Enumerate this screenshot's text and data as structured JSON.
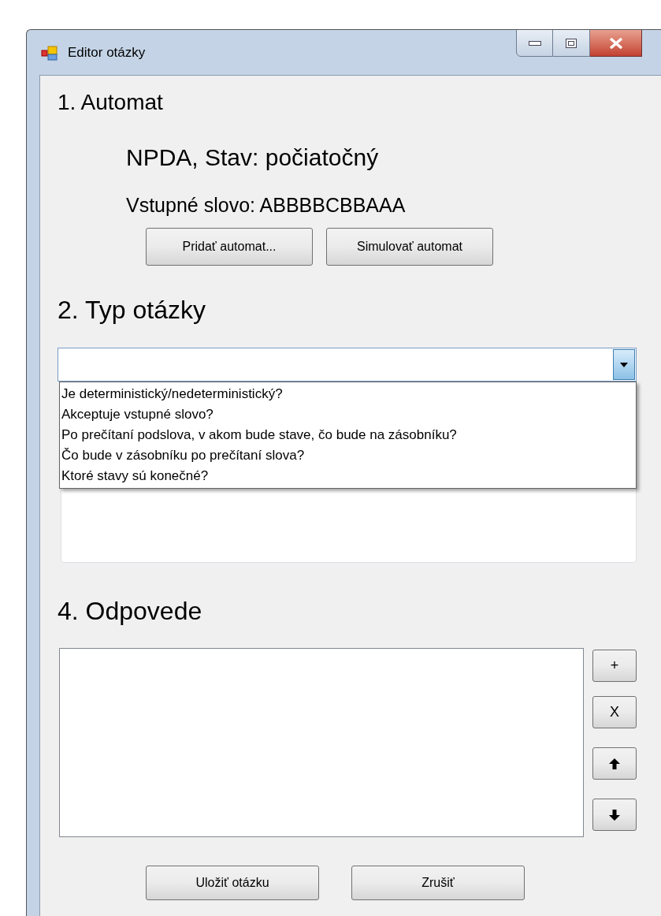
{
  "window": {
    "title": "Editor otázky"
  },
  "automat": {
    "heading": "1. Automat",
    "lines": [
      "NPDA, Stav: počiatočný",
      "Vstupné slovo: ABBBBCBBAAA"
    ],
    "buttons": [
      "Pridať automat...",
      "Simulovať automat"
    ]
  },
  "question_type": {
    "heading": "2. Typ otázky",
    "combobox": {
      "expanded": true
    },
    "options": [
      {
        "label": "Je deterministický/nedeterministický?",
        "selected": false
      },
      {
        "label": "Akceptuje vstupné slovo?",
        "selected": false
      },
      {
        "label": "Po prečítaní podslova, v akom bude stave, čo bude na zásobníku?",
        "selected": false
      },
      {
        "label": "Čo bude v zásobníku po prečítaní slova?",
        "selected": false
      },
      {
        "label": "Ktoré stavy sú konečné?",
        "selected": false
      }
    ]
  },
  "answers": {
    "heading": "4. Odpovede",
    "side_buttons": [
      {
        "kind": "text",
        "label": "+"
      },
      {
        "kind": "text",
        "label": "X"
      },
      {
        "kind": "arrow_up"
      },
      {
        "kind": "arrow_down"
      }
    ]
  },
  "footer_buttons": [
    "Uložiť otázku",
    "Zrušiť"
  ]
}
